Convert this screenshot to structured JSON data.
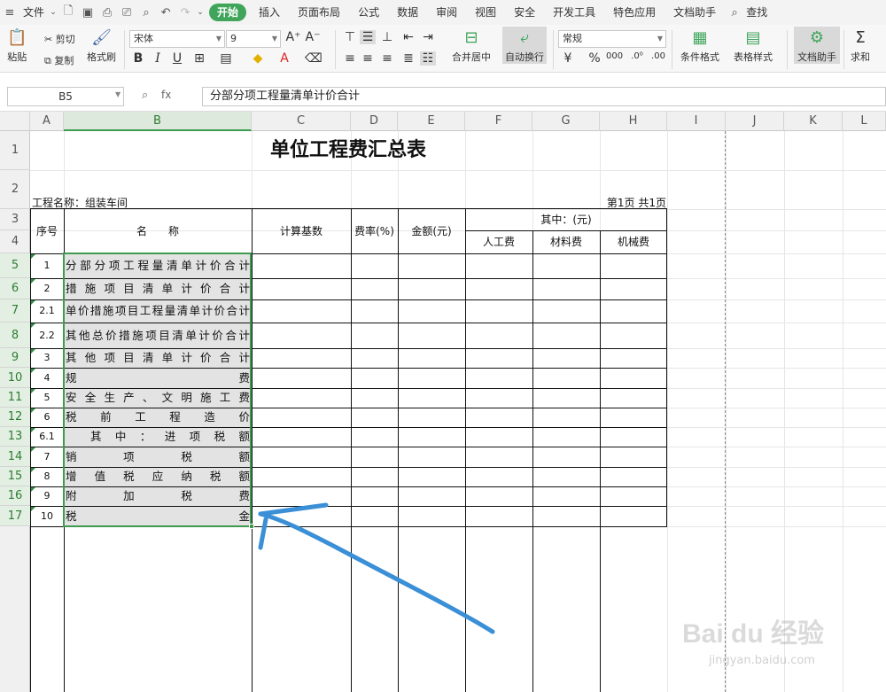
{
  "menubar": {
    "file": "文件",
    "tabs": [
      "开始",
      "插入",
      "页面布局",
      "公式",
      "数据",
      "审阅",
      "视图",
      "安全",
      "开发工具",
      "特色应用",
      "文档助手"
    ],
    "search": "查找"
  },
  "ribbon": {
    "paste": "粘贴",
    "cut": "剪切",
    "copy": "复制",
    "format_painter": "格式刷",
    "font_name": "宋体",
    "font_size": "9",
    "merge_center": "合并居中",
    "wrap_text": "自动换行",
    "number_format": "常规",
    "cond_format": "条件格式",
    "table_style": "表格样式",
    "doc_assistant": "文档助手",
    "sum": "求和"
  },
  "formula_bar": {
    "name_box": "B5",
    "fx": "fx",
    "content": "分部分项工程量清单计价合计"
  },
  "columns": [
    "A",
    "B",
    "C",
    "D",
    "E",
    "F",
    "G",
    "H",
    "I",
    "J",
    "K",
    "L"
  ],
  "rows": [
    "1",
    "2",
    "3",
    "4",
    "5",
    "6",
    "7",
    "8",
    "9",
    "10",
    "11",
    "12",
    "13",
    "14",
    "15",
    "16",
    "17"
  ],
  "sheet": {
    "title": "单位工程费汇总表",
    "project_label": "工程名称：组装车间",
    "page_label": "第1页 共1页",
    "headers": {
      "seq": "序号",
      "name": "名　　称",
      "base": "计算基数",
      "rate": "费率(%)",
      "amount": "金额(元)",
      "among": "其中：(元)",
      "labor": "人工费",
      "material": "材料费",
      "machine": "机械费"
    },
    "items": [
      {
        "no": "1",
        "name": "分部分项工程量清单计价合计"
      },
      {
        "no": "2",
        "name": "措施项目清单计价合计"
      },
      {
        "no": "2.1",
        "name": "单价措施项目工程量清单计价合计"
      },
      {
        "no": "2.2",
        "name": "其他总价措施项目清单计价合计"
      },
      {
        "no": "3",
        "name": "其他项目清单计价合计"
      },
      {
        "no": "4",
        "name": "规费"
      },
      {
        "no": "5",
        "name": "安全生产、文明施工费"
      },
      {
        "no": "6",
        "name": "税前工程造价"
      },
      {
        "no": "6.1",
        "name": "其中：进项税额"
      },
      {
        "no": "7",
        "name": "销项税额"
      },
      {
        "no": "8",
        "name": "增值税应纳税额"
      },
      {
        "no": "9",
        "name": "附加税费"
      },
      {
        "no": "10",
        "name": "税金"
      }
    ]
  },
  "watermark": {
    "brand": "Bai du 经验",
    "url": "jingyan.baidu.com"
  },
  "colors": {
    "accent": "#3fa55b",
    "selection": "#3e9b4f",
    "annotation": "#3a8fd6"
  }
}
